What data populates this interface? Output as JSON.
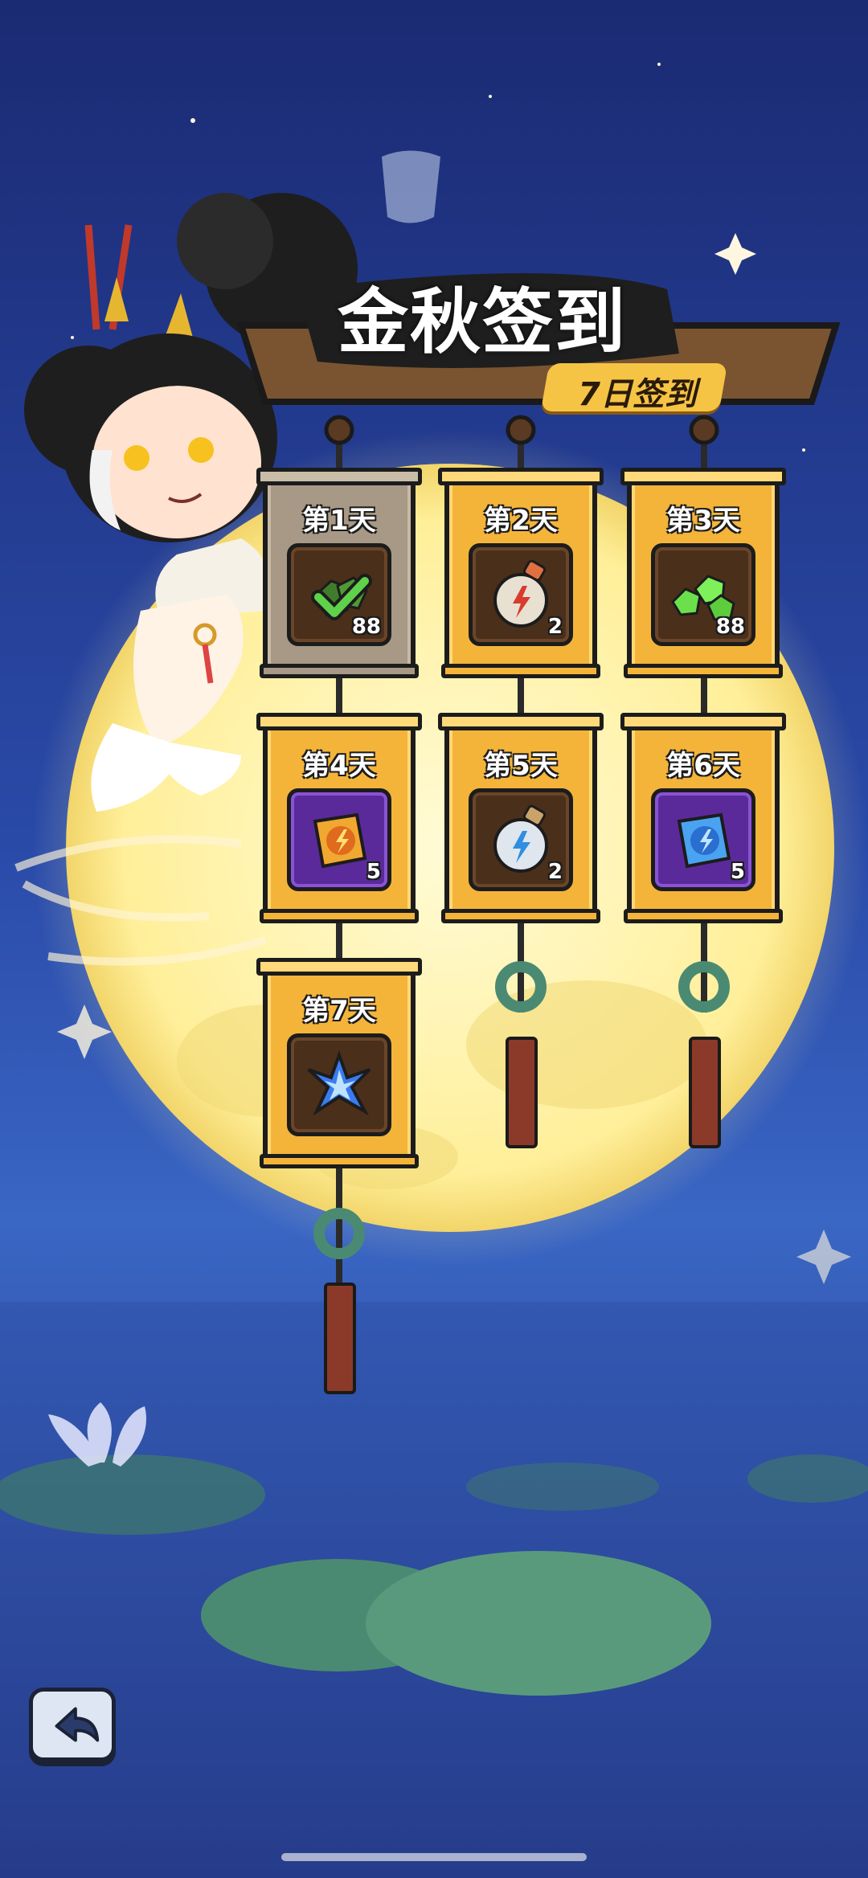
{
  "header": {
    "title": "金秋签到",
    "subtitle": "7日签到"
  },
  "days": [
    {
      "label": "第1天",
      "count": "88",
      "item": "green-gem-icon",
      "claimed": true
    },
    {
      "label": "第2天",
      "count": "2",
      "item": "red-potion-icon",
      "claimed": false
    },
    {
      "label": "第3天",
      "count": "88",
      "item": "green-gem-icon",
      "claimed": false
    },
    {
      "label": "第4天",
      "count": "5",
      "item": "orange-card-pack-icon",
      "claimed": false
    },
    {
      "label": "第5天",
      "count": "2",
      "item": "blue-potion-icon",
      "claimed": false
    },
    {
      "label": "第6天",
      "count": "5",
      "item": "blue-card-pack-icon",
      "claimed": false
    },
    {
      "label": "第7天",
      "count": "",
      "item": "blue-crystal-icon",
      "claimed": false
    }
  ],
  "colors": {
    "sky": "#1d2f78",
    "moon": "#fff2a8",
    "card_gold": "#f4b43a",
    "card_claimed": "#a79985",
    "accent": "#f6c445"
  }
}
